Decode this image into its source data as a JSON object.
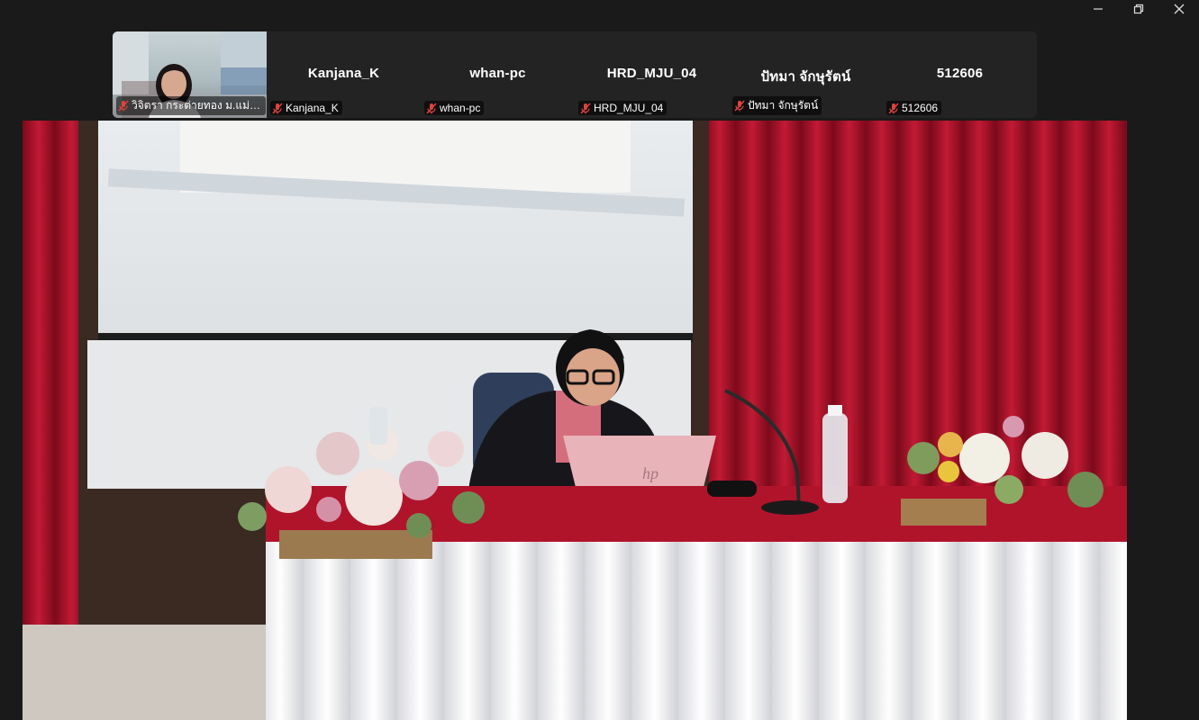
{
  "window": {
    "controls": [
      {
        "name": "minimize-icon"
      },
      {
        "name": "restore-icon"
      },
      {
        "name": "close-icon"
      }
    ]
  },
  "participants": [
    {
      "tile_label": "",
      "tag_label": "วิจิตรา กระต่ายทอง ม.แม่โจ้-...",
      "muted": true,
      "has_video": true
    },
    {
      "tile_label": "Kanjana_K",
      "tag_label": "Kanjana_K",
      "muted": true,
      "has_video": false
    },
    {
      "tile_label": "whan-pc",
      "tag_label": "whan-pc",
      "muted": true,
      "has_video": false
    },
    {
      "tile_label": "HRD_MJU_04",
      "tag_label": "HRD_MJU_04",
      "muted": true,
      "has_video": false
    },
    {
      "tile_label": "ปัทมา  จักษุรัตน์",
      "tag_label": "ปัทมา  จักษุรัตน์",
      "muted": true,
      "has_video": false
    },
    {
      "tile_label": "512606",
      "tag_label": "512606",
      "muted": true,
      "has_video": false
    }
  ],
  "colors": {
    "app_bg": "#1a1a1a",
    "strip_bg": "#232323",
    "muted_icon": "#e0423c",
    "curtain": "#a8112a",
    "tablecloth": "#f3f3f5"
  }
}
